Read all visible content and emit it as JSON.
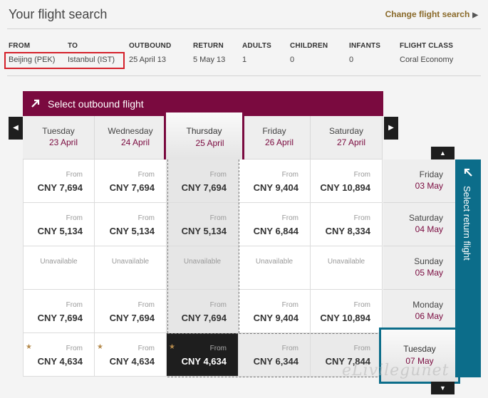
{
  "header": {
    "title": "Your flight search",
    "change_link": "Change flight search",
    "change_arrow": "▶"
  },
  "summary": {
    "from_label": "FROM",
    "from_value": "Beijing (PEK)",
    "to_label": "TO",
    "to_value": "Istanbul (IST)",
    "outbound_label": "OUTBOUND",
    "outbound_value": "25 April 13",
    "return_label": "RETURN",
    "return_value": "5 May 13",
    "adults_label": "ADULTS",
    "adults_value": "1",
    "children_label": "CHILDREN",
    "children_value": "0",
    "infants_label": "INFANTS",
    "infants_value": "0",
    "class_label": "FLIGHT CLASS",
    "class_value": "Coral Economy"
  },
  "outbound": {
    "label": "Select outbound flight",
    "prev_glyph": "◀",
    "next_glyph": "▶",
    "dates": [
      {
        "day": "Tuesday",
        "date": "23 April"
      },
      {
        "day": "Wednesday",
        "date": "24 April"
      },
      {
        "day": "Thursday",
        "date": "25 April"
      },
      {
        "day": "Friday",
        "date": "26 April"
      },
      {
        "day": "Saturday",
        "date": "27 April"
      }
    ]
  },
  "return": {
    "label": "Select return flight",
    "up_glyph": "▲",
    "down_glyph": "▼",
    "dates": [
      {
        "day": "Friday",
        "date": "03 May"
      },
      {
        "day": "Saturday",
        "date": "04 May"
      },
      {
        "day": "Sunday",
        "date": "05 May"
      },
      {
        "day": "Monday",
        "date": "06 May"
      },
      {
        "day": "Tuesday",
        "date": "07 May"
      }
    ]
  },
  "from_text": "From",
  "unavailable_text": "Unavailable",
  "star_glyph": "★",
  "prices": [
    [
      "CNY 7,694",
      "CNY 7,694",
      "CNY 7,694",
      "CNY 9,404",
      "CNY 10,894"
    ],
    [
      "CNY 5,134",
      "CNY 5,134",
      "CNY 5,134",
      "CNY 6,844",
      "CNY 8,334"
    ],
    [
      "Unavailable",
      "Unavailable",
      "Unavailable",
      "Unavailable",
      "Unavailable"
    ],
    [
      "CNY 7,694",
      "CNY 7,694",
      "CNY 7,694",
      "CNY 9,404",
      "CNY 10,894"
    ],
    [
      "CNY 4,634",
      "CNY 4,634",
      "CNY 4,634",
      "CNY 6,344",
      "CNY 7,844"
    ]
  ],
  "watermark": "eLivilegunet",
  "colors": {
    "outbound_accent": "#7a0a3f",
    "return_accent": "#0c6d8a",
    "highlight_box": "#d4202a",
    "link": "#8a6a2a"
  }
}
